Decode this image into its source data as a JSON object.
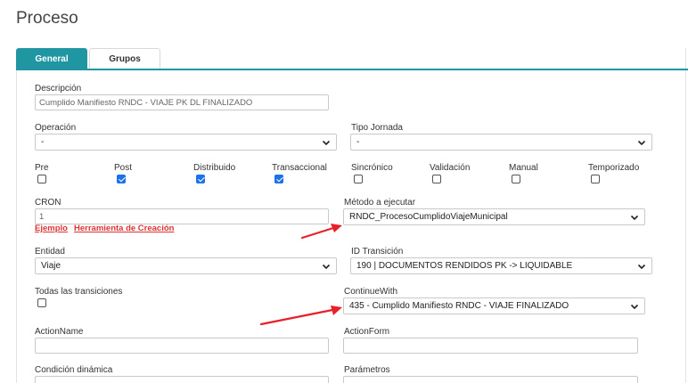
{
  "page": {
    "title": "Proceso"
  },
  "tabs": [
    {
      "label": "General",
      "active": true
    },
    {
      "label": "Grupos",
      "active": false
    }
  ],
  "form": {
    "descripcion": {
      "label": "Descripción",
      "value": "Cumplido Manifiesto RNDC - VIAJE PK DL FINALIZADO"
    },
    "operacion": {
      "label": "Operación",
      "value": "-"
    },
    "tipo_jornada": {
      "label": "Tipo Jornada",
      "value": "-"
    },
    "checkboxes": [
      {
        "label": "Pre",
        "checked": false
      },
      {
        "label": "Post",
        "checked": true
      },
      {
        "label": "Distribuido",
        "checked": true
      },
      {
        "label": "Transaccional",
        "checked": true
      },
      {
        "label": "Sincrónico",
        "checked": false
      },
      {
        "label": "Validación",
        "checked": false
      },
      {
        "label": "Manual",
        "checked": false
      },
      {
        "label": "Temporizado",
        "checked": false
      }
    ],
    "cron": {
      "label": "CRON",
      "placeholder": "1",
      "link_ejemplo": "Ejemplo",
      "link_herramienta": "Herramienta de Creación"
    },
    "metodo": {
      "label": "Método a ejecutar",
      "value": "RNDC_ProcesoCumplidoViajeMunicipal"
    },
    "entidad": {
      "label": "Entidad",
      "value": "Viaje"
    },
    "id_transicion": {
      "label": "ID Transición",
      "value": "190 | DOCUMENTOS RENDIDOS PK -> LIQUIDABLE"
    },
    "todas_transiciones": {
      "label": "Todas las transiciones",
      "checked": false
    },
    "continue_with": {
      "label": "ContinueWith",
      "value": "435 - Cumplido Manifiesto RNDC - VIAJE FINALIZADO"
    },
    "action_name": {
      "label": "ActionName",
      "value": ""
    },
    "action_form": {
      "label": "ActionForm",
      "value": ""
    },
    "condicion": {
      "label": "Condición dinámica",
      "value": ""
    },
    "parametros": {
      "label": "Parámetros",
      "value": ""
    }
  },
  "colors": {
    "accent": "#2196a3",
    "checkbox": "#1a73e8",
    "link": "#dd3333",
    "arrow": "#e8202a"
  },
  "icons": {
    "select": "chevron-down-icon",
    "annotation": "red-arrow-icon"
  }
}
